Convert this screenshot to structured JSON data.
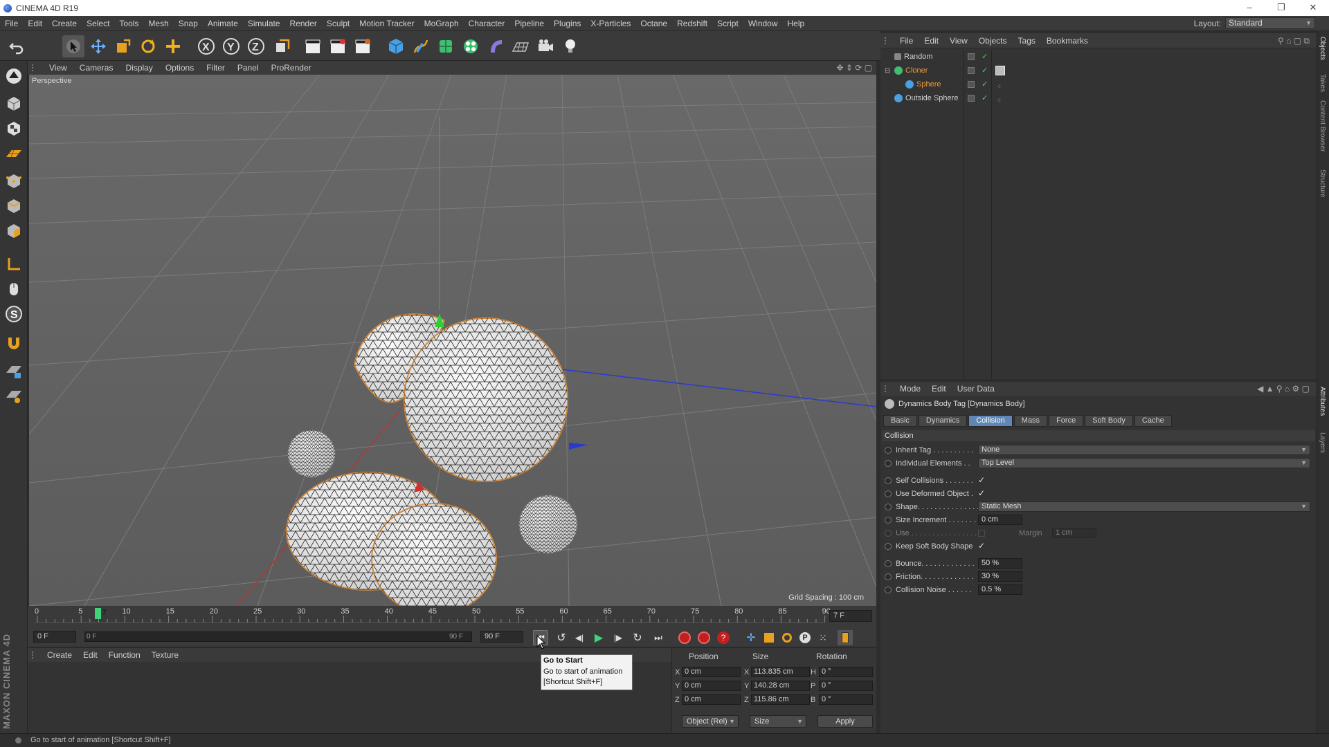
{
  "window": {
    "title": "CINEMA 4D R19",
    "controls": [
      "–",
      "❐",
      "✕"
    ]
  },
  "menu": [
    "File",
    "Edit",
    "Create",
    "Select",
    "Tools",
    "Mesh",
    "Snap",
    "Animate",
    "Simulate",
    "Render",
    "Sculpt",
    "Motion Tracker",
    "MoGraph",
    "Character",
    "Pipeline",
    "Plugins",
    "X-Particles",
    "Octane",
    "Redshift",
    "Script",
    "Window",
    "Help"
  ],
  "layout": {
    "label": "Layout:",
    "value": "Standard"
  },
  "viewport": {
    "menu": [
      "View",
      "Cameras",
      "Display",
      "Options",
      "Filter",
      "Panel",
      "ProRender"
    ],
    "camera_label": "Perspective",
    "grid_spacing": "Grid Spacing : 100 cm"
  },
  "timeline": {
    "ticks": [
      "0",
      "5",
      "10",
      "15",
      "20",
      "25",
      "30",
      "35",
      "40",
      "45",
      "50",
      "55",
      "60",
      "65",
      "70",
      "75",
      "80",
      "85",
      "90"
    ],
    "current_frame": "7",
    "current_frame_field": "7 F",
    "start_field": "0 F",
    "range_start": "0 F",
    "range_end": "90 F",
    "end_field": "90 F"
  },
  "material_manager": {
    "menu": [
      "Create",
      "Edit",
      "Function",
      "Texture"
    ]
  },
  "coordinates": {
    "headers": {
      "position": "Position",
      "size": "Size",
      "rotation": "Rotation"
    },
    "rows": [
      {
        "axis": "X",
        "pos": "0 cm",
        "size_axis": "X",
        "size": "113.835 cm",
        "rot_axis": "H",
        "rot": "0 °"
      },
      {
        "axis": "Y",
        "pos": "0 cm",
        "size_axis": "Y",
        "size": "140.28 cm",
        "rot_axis": "P",
        "rot": "0 °"
      },
      {
        "axis": "Z",
        "pos": "0 cm",
        "size_axis": "Z",
        "size": "115.86 cm",
        "rot_axis": "B",
        "rot": "0 °"
      }
    ],
    "mode_select": "Object (Rel)",
    "size_select": "Size",
    "apply": "Apply"
  },
  "tooltip": {
    "title": "Go to Start",
    "desc": "Go to start of animation",
    "shortcut": "[Shortcut Shift+F]"
  },
  "status": "Go to start of animation [Shortcut Shift+F]",
  "brand": "MAXON CINEMA 4D",
  "objects": {
    "menu": [
      "File",
      "Edit",
      "View",
      "Objects",
      "Tags",
      "Bookmarks"
    ],
    "items": [
      {
        "name": "Random",
        "color": "#d0d0d0"
      },
      {
        "name": "Cloner",
        "color": "#e89a3a"
      },
      {
        "name": "Sphere",
        "color": "#e89a3a"
      },
      {
        "name": "Outside Sphere",
        "color": "#d0d0d0"
      }
    ]
  },
  "attributes": {
    "menu": [
      "Mode",
      "Edit",
      "User Data"
    ],
    "title": "Dynamics Body Tag [Dynamics Body]",
    "tabs": [
      "Basic",
      "Dynamics",
      "Collision",
      "Mass",
      "Force",
      "Soft Body",
      "Cache"
    ],
    "active_tab": "Collision",
    "section": "Collision",
    "fields": {
      "inherit_tag": {
        "label": "Inherit Tag . . . . . . . . . .",
        "value": "None"
      },
      "individual_elements": {
        "label": "Individual Elements . .",
        "value": "Top Level"
      },
      "self_collisions": {
        "label": "Self Collisions . . . . . . .",
        "value": "✓"
      },
      "use_deformed": {
        "label": "Use Deformed Object .",
        "value": "✓"
      },
      "shape": {
        "label": "Shape. . . . . . . . . . . . . . .",
        "value": "Static Mesh"
      },
      "size_increment": {
        "label": "Size Increment . . . . . . .",
        "value": "0 cm"
      },
      "use": {
        "label": "Use . . . . . . . . . . . . . . . .",
        "margin_label": "Margin",
        "margin_value": "1 cm"
      },
      "keep_soft": {
        "label": "Keep Soft Body Shape",
        "value": "✓"
      },
      "bounce": {
        "label": "Bounce. . . . . . . . . . . . .",
        "value": "50 %"
      },
      "friction": {
        "label": "Friction. . . . . . . . . . . . .",
        "value": "30 %"
      },
      "collision_noise": {
        "label": "Collision Noise . . . . . .",
        "value": "0.5 %"
      }
    }
  },
  "side_tabs": [
    "Objects",
    "Takes",
    "Content Browser",
    "Structure",
    "Attributes",
    "Layers"
  ],
  "colors": {
    "accent": "#5f86b6",
    "orange": "#e89a3a",
    "playhead": "#3fd47a"
  }
}
